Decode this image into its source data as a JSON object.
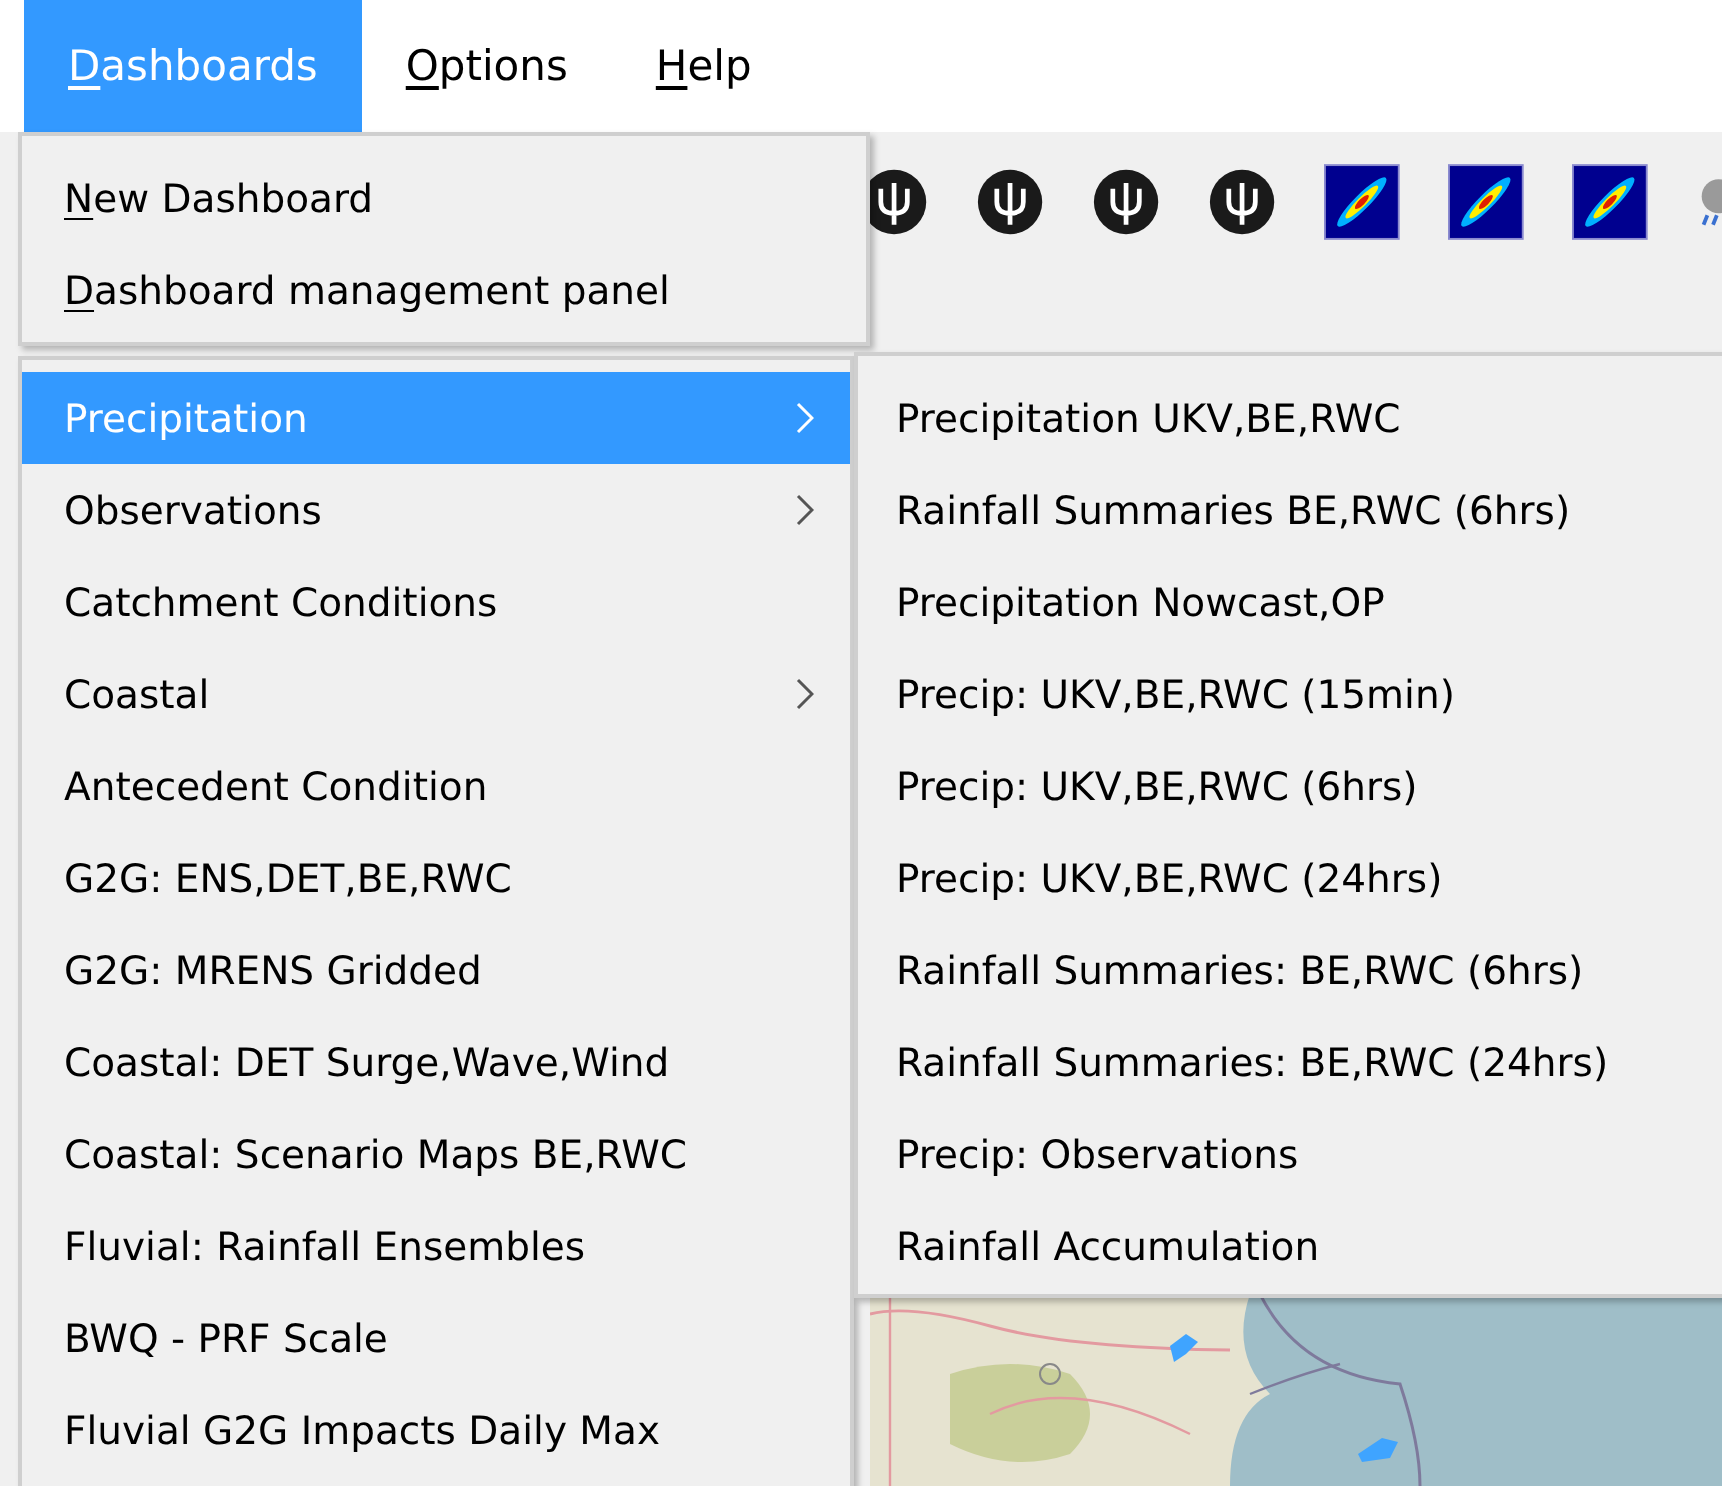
{
  "menubar": [
    {
      "label": "Dashboards",
      "mnemonic_underlined": true,
      "selected": true
    },
    {
      "label": "Options",
      "mnemonic_underlined": true,
      "selected": false
    },
    {
      "label": "Help",
      "mnemonic_underlined": true,
      "selected": false
    }
  ],
  "toolbar": {
    "items": [
      {
        "kind": "trident"
      },
      {
        "kind": "trident"
      },
      {
        "kind": "trident"
      },
      {
        "kind": "trident"
      },
      {
        "kind": "heatmap"
      },
      {
        "kind": "heatmap"
      },
      {
        "kind": "heatmap"
      },
      {
        "kind": "cloud"
      }
    ]
  },
  "dashboards_menu": {
    "top_items": [
      {
        "label": "New Dashboard",
        "mnemonic_underlined": true
      },
      {
        "label": "Dashboard management panel",
        "mnemonic_underlined": true
      }
    ],
    "items": [
      {
        "label": "Precipitation",
        "has_submenu": true,
        "selected": true
      },
      {
        "label": "Observations",
        "has_submenu": true,
        "selected": false
      },
      {
        "label": "Catchment Conditions",
        "has_submenu": false,
        "selected": false
      },
      {
        "label": "Coastal",
        "has_submenu": true,
        "selected": false
      },
      {
        "label": "Antecedent Condition",
        "has_submenu": false,
        "selected": false
      },
      {
        "label": "G2G: ENS,DET,BE,RWC",
        "has_submenu": false,
        "selected": false
      },
      {
        "label": "G2G: MRENS Gridded",
        "has_submenu": false,
        "selected": false
      },
      {
        "label": "Coastal: DET Surge,Wave,Wind",
        "has_submenu": false,
        "selected": false
      },
      {
        "label": "Coastal: Scenario Maps BE,RWC",
        "has_submenu": false,
        "selected": false
      },
      {
        "label": "Fluvial: Rainfall Ensembles",
        "has_submenu": false,
        "selected": false
      },
      {
        "label": "BWQ - PRF Scale",
        "has_submenu": false,
        "selected": false
      },
      {
        "label": "Fluvial G2G Impacts Daily Max",
        "has_submenu": false,
        "selected": false
      }
    ]
  },
  "precipitation_submenu": {
    "items": [
      "Precipitation UKV,BE,RWC",
      "Rainfall Summaries BE,RWC (6hrs)",
      "Precipitation Nowcast,OP",
      "Precip: UKV,BE,RWC (15min)",
      "Precip: UKV,BE,RWC (6hrs)",
      "Precip: UKV,BE,RWC (24hrs)",
      "Rainfall Summaries: BE,RWC (6hrs)",
      "Rainfall Summaries: BE,RWC (24hrs)",
      "Precip: Observations",
      "Rainfall Accumulation"
    ]
  }
}
